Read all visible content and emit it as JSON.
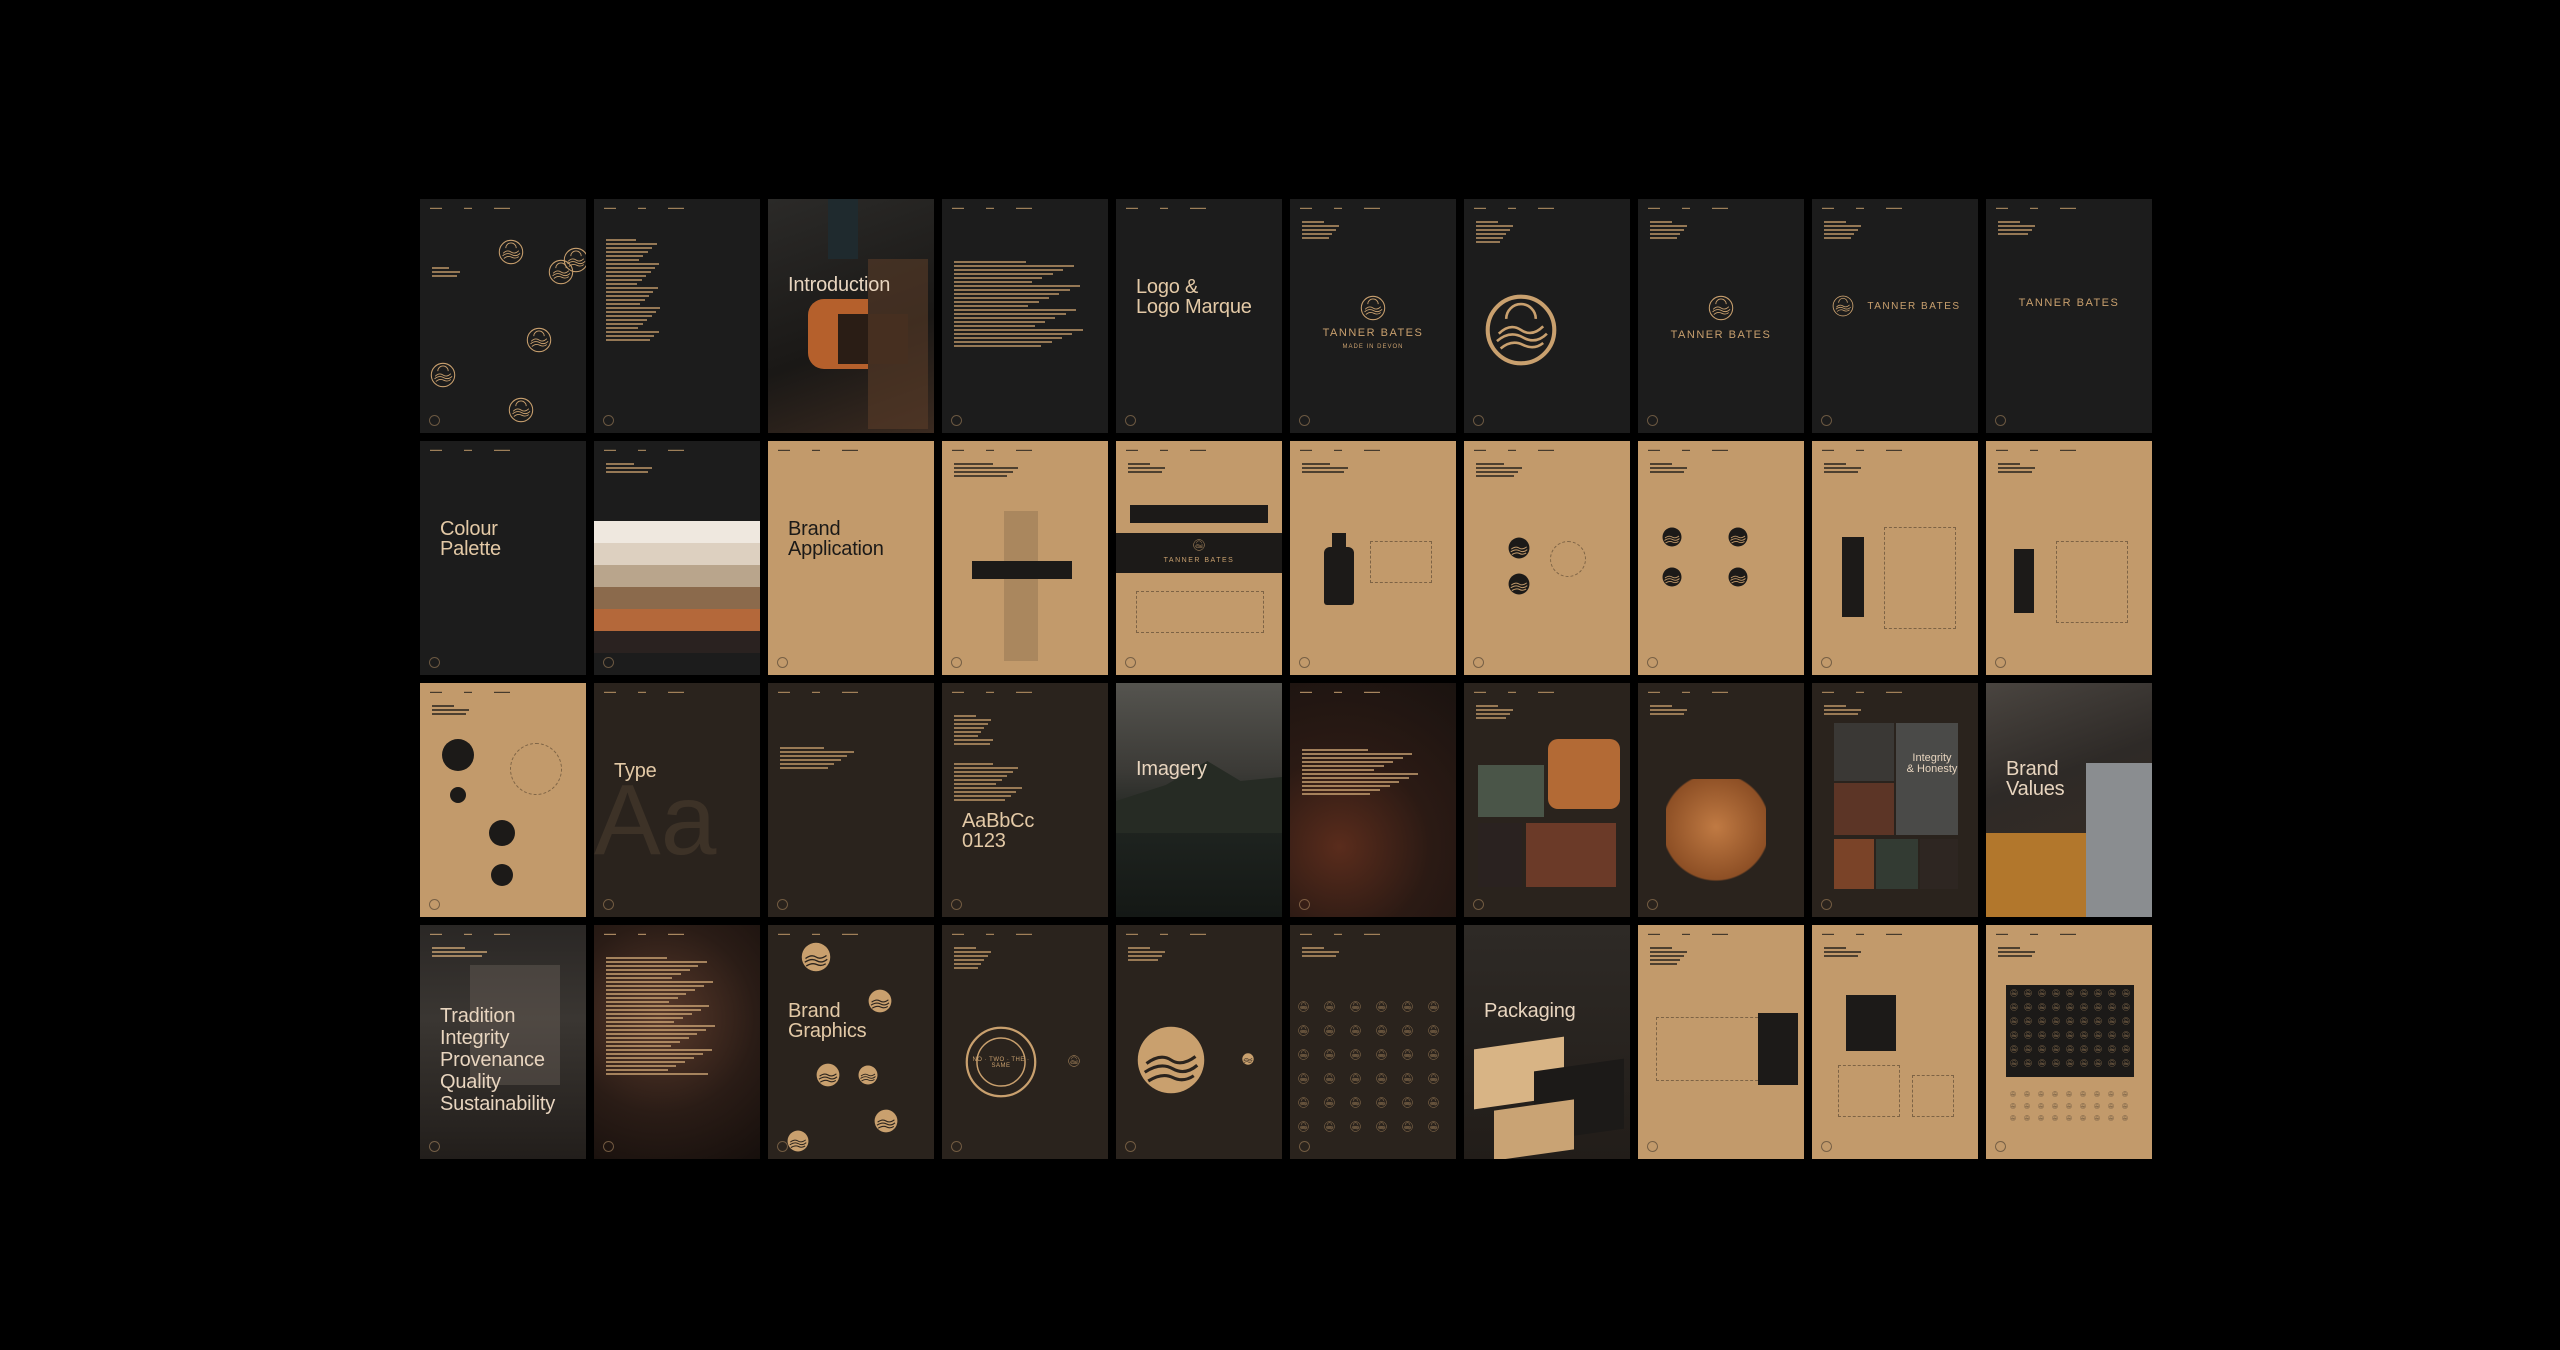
{
  "theme": {
    "background": "#000000",
    "dark": "#1c1c1c",
    "brown": "#2a231d",
    "tan": "#c29a6b",
    "gold": "#c9a06e"
  },
  "rows": [
    [
      {
        "id": "cover",
        "theme": "dark",
        "title": "",
        "icon": "sun-hills-logo-icon"
      },
      {
        "id": "contents",
        "theme": "dark",
        "title": "",
        "icon": "text-lines-icon"
      },
      {
        "id": "introduction",
        "theme": "photo",
        "title": "Introduction",
        "icon": "clamp-photo"
      },
      {
        "id": "intro-text",
        "theme": "dark",
        "title": "",
        "icon": "text-lines-icon"
      },
      {
        "id": "logo-marque",
        "theme": "dark",
        "title": "Logo &\nLogo Marque",
        "icon": ""
      },
      {
        "id": "logo-primary",
        "theme": "dark",
        "title": "",
        "wordmark": "TANNER BATES",
        "tagline": "MADE IN DEVON",
        "icon": "sun-hills-logo-icon"
      },
      {
        "id": "logo-marque-large",
        "theme": "dark",
        "title": "",
        "icon": "sun-hills-logo-icon"
      },
      {
        "id": "logo-stacked",
        "theme": "dark",
        "title": "",
        "wordmark": "TANNER BATES",
        "icon": "sun-hills-logo-icon"
      },
      {
        "id": "logo-horizontal",
        "theme": "dark",
        "title": "",
        "wordmark": "TANNER BATES",
        "icon": "sun-hills-logo-icon"
      },
      {
        "id": "logo-wordmark",
        "theme": "dark",
        "title": "",
        "wordmark": "TANNER BATES",
        "icon": ""
      }
    ],
    [
      {
        "id": "colour-palette",
        "theme": "dark",
        "title": "Colour\nPalette",
        "icon": ""
      },
      {
        "id": "colour-swatches",
        "theme": "dark",
        "title": "",
        "icon": "colour-swatch-icon"
      },
      {
        "id": "brand-application",
        "theme": "tan",
        "title": "Brand\nApplication",
        "icon": ""
      },
      {
        "id": "app-label",
        "theme": "tan",
        "title": "",
        "icon": "label-icon"
      },
      {
        "id": "app-strip",
        "theme": "tan",
        "title": "",
        "wordmark": "TANNER BATES",
        "icon": "label-icon"
      },
      {
        "id": "app-bottle",
        "theme": "tan",
        "title": "",
        "icon": "bottle-icon"
      },
      {
        "id": "app-stickers-2",
        "theme": "tan",
        "title": "",
        "icon": "sticker-icon"
      },
      {
        "id": "app-stickers-4",
        "theme": "tan",
        "title": "",
        "icon": "sticker-icon"
      },
      {
        "id": "app-tag-tall",
        "theme": "tan",
        "title": "",
        "icon": "tag-icon"
      },
      {
        "id": "app-tag",
        "theme": "tan",
        "title": "",
        "icon": "tag-icon"
      }
    ],
    [
      {
        "id": "app-circles",
        "theme": "tan",
        "title": "",
        "icon": "sticker-icon"
      },
      {
        "id": "type",
        "theme": "brown",
        "title": "Type",
        "ghost": "Aa",
        "icon": ""
      },
      {
        "id": "type-text",
        "theme": "brown",
        "title": "",
        "icon": "text-lines-icon"
      },
      {
        "id": "type-specimen",
        "theme": "brown",
        "title": "AaBbCc\n0123",
        "icon": ""
      },
      {
        "id": "imagery",
        "theme": "photo",
        "title": "Imagery",
        "icon": "landscape-photo"
      },
      {
        "id": "imagery-text",
        "theme": "photo",
        "title": "",
        "icon": "leather-photo"
      },
      {
        "id": "imagery-collage",
        "theme": "brown",
        "title": "",
        "icon": "collage-photo"
      },
      {
        "id": "imagery-backpack",
        "theme": "brown",
        "title": "",
        "icon": "backpack-photo"
      },
      {
        "id": "imagery-grid",
        "theme": "brown",
        "title": "",
        "label": "Integrity\n& Honesty",
        "icon": "collage-photo"
      },
      {
        "id": "brand-values",
        "theme": "photo",
        "title": "Brand\nValues",
        "icon": "workshop-photo"
      }
    ],
    [
      {
        "id": "values-list",
        "theme": "photo",
        "title": "Tradition\nIntegrity\nProvenance\nQuality\nSustainability",
        "icon": "craftsman-photo"
      },
      {
        "id": "values-text",
        "theme": "photo",
        "title": "",
        "icon": "leather-rolls-photo"
      },
      {
        "id": "brand-graphics",
        "theme": "brown",
        "title": "Brand\nGraphics",
        "icon": "sun-hills-logo-icon"
      },
      {
        "id": "graphics-badge",
        "theme": "brown",
        "title": "",
        "badge": "NO · TWO · THE · SAME",
        "icon": "badge-icon"
      },
      {
        "id": "graphics-marque",
        "theme": "brown",
        "title": "",
        "icon": "sun-hills-logo-icon"
      },
      {
        "id": "graphics-pattern",
        "theme": "brown",
        "title": "",
        "icon": "pattern-icon"
      },
      {
        "id": "packaging",
        "theme": "photo",
        "title": "Packaging",
        "icon": "boxes-photo"
      },
      {
        "id": "pack-dieline",
        "theme": "tan",
        "title": "",
        "icon": "dieline-icon"
      },
      {
        "id": "pack-box",
        "theme": "tan",
        "title": "",
        "icon": "box-icon"
      },
      {
        "id": "pack-tissue",
        "theme": "tan",
        "title": "",
        "icon": "pattern-icon"
      }
    ]
  ]
}
